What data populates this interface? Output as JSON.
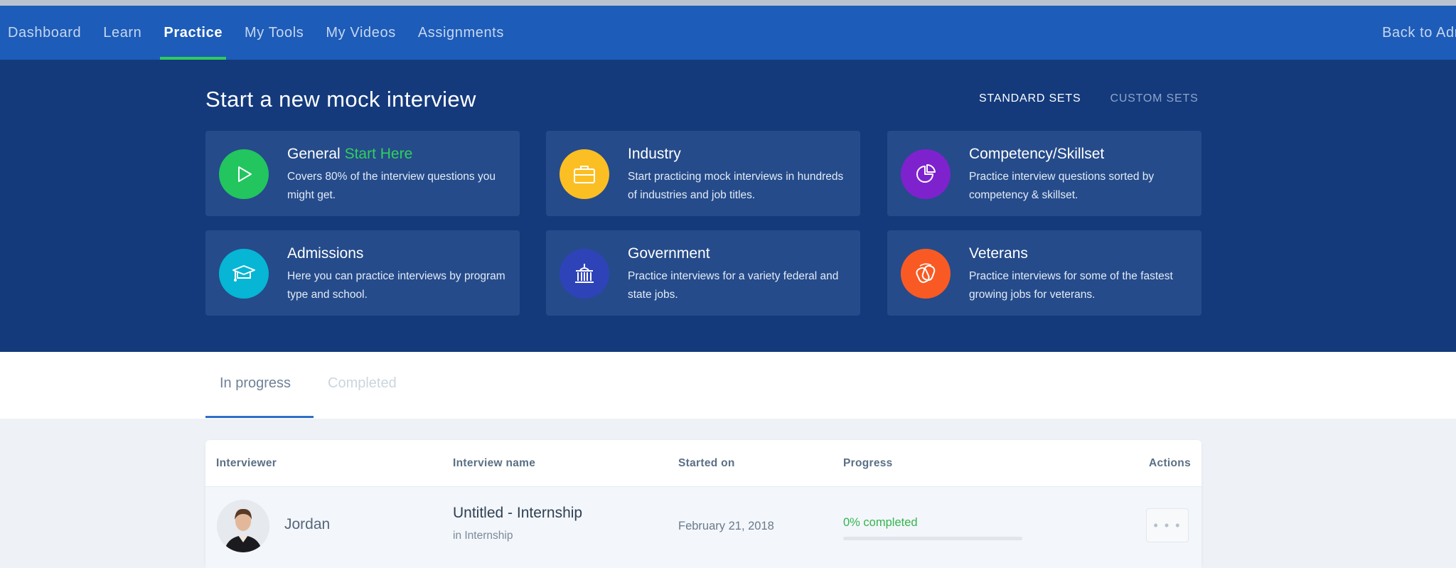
{
  "nav": {
    "items": [
      "Dashboard",
      "Learn",
      "Practice",
      "My Tools",
      "My Videos",
      "Assignments"
    ],
    "active": "Practice",
    "right_link": "Back to Admi"
  },
  "hero": {
    "title": "Start a new mock interview",
    "set_tabs": [
      {
        "label": "STANDARD SETS",
        "active": true
      },
      {
        "label": "CUSTOM SETS",
        "active": false
      }
    ],
    "cards": [
      {
        "title": "General",
        "title_accent": "Start Here",
        "desc": "Covers 80% of the interview questions you might get.",
        "icon": "play-icon",
        "color": "#22c55e"
      },
      {
        "title": "Industry",
        "title_accent": "",
        "desc": "Start practicing mock interviews in hundreds of industries and job titles.",
        "icon": "briefcase-icon",
        "color": "#fbbf24"
      },
      {
        "title": "Competency/Skillset",
        "title_accent": "",
        "desc": "Practice interview questions sorted by competency & skillset.",
        "icon": "pie-chart-icon",
        "color": "#7e22ce"
      },
      {
        "title": "Admissions",
        "title_accent": "",
        "desc": "Here you can practice interviews by program type and school.",
        "icon": "graduation-cap-icon",
        "color": "#06b6d4"
      },
      {
        "title": "Government",
        "title_accent": "",
        "desc": "Practice interviews for a variety federal and state jobs.",
        "icon": "government-building-icon",
        "color": "#2f43b8"
      },
      {
        "title": "Veterans",
        "title_accent": "",
        "desc": "Practice interviews for some of the fastest growing jobs for veterans.",
        "icon": "dog-tags-icon",
        "color": "#f95a24"
      }
    ]
  },
  "progress_tabs": {
    "in_progress": "In progress",
    "completed": "Completed"
  },
  "table": {
    "headers": {
      "interviewer": "Interviewer",
      "interview_name": "Interview name",
      "started_on": "Started on",
      "progress": "Progress",
      "actions": "Actions"
    },
    "rows": [
      {
        "interviewer": "Jordan",
        "interview_name": "Untitled - Internship",
        "interview_sub": "in Internship",
        "started_on": "February 21, 2018",
        "progress_text": "0% completed",
        "progress_value": 0,
        "actions_label": "• • •"
      }
    ]
  }
}
